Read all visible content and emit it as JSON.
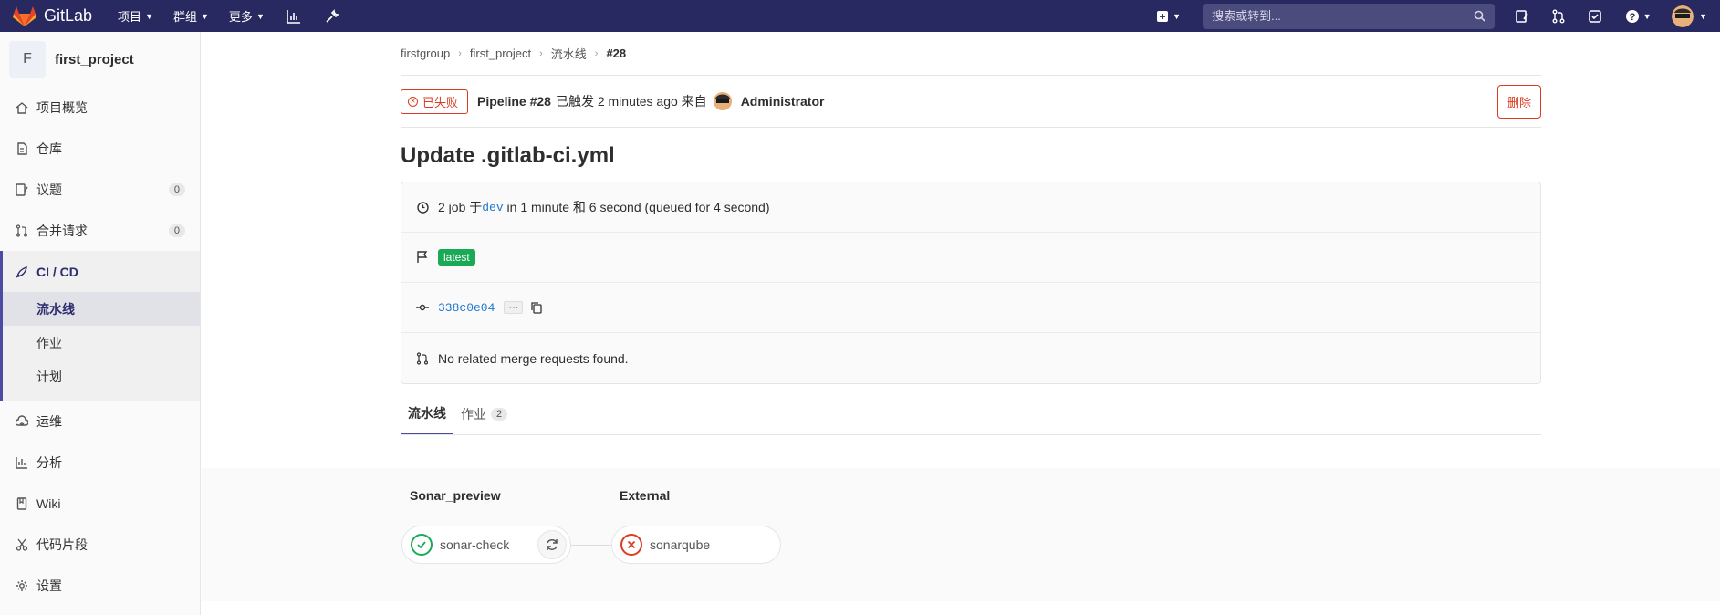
{
  "topbar": {
    "brand": "GitLab",
    "menu": [
      {
        "label": "项目"
      },
      {
        "label": "群组"
      },
      {
        "label": "更多"
      }
    ],
    "search_placeholder": "搜索或转到..."
  },
  "sidebar": {
    "project_initial": "F",
    "project_name": "first_project",
    "items": [
      {
        "label": "项目概览"
      },
      {
        "label": "仓库"
      },
      {
        "label": "议题",
        "count": "0"
      },
      {
        "label": "合并请求",
        "count": "0"
      }
    ],
    "cicd": {
      "label": "CI / CD",
      "subitems": [
        {
          "label": "流水线"
        },
        {
          "label": "作业"
        },
        {
          "label": "计划"
        }
      ]
    },
    "items_after": [
      {
        "label": "运维"
      },
      {
        "label": "分析"
      },
      {
        "label": "Wiki"
      },
      {
        "label": "代码片段"
      },
      {
        "label": "设置"
      }
    ]
  },
  "breadcrumb": [
    "firstgroup",
    "first_project",
    "流水线",
    "#28"
  ],
  "pipeline": {
    "status": "已失败",
    "title": "Pipeline #28",
    "meta": "已触发 2 minutes ago 来自",
    "author": "Administrator",
    "delete_label": "删除",
    "commit_title": "Update .gitlab-ci.yml",
    "info": {
      "jobs_prefix": "2 job 于",
      "branch": "dev",
      "jobs_suffix": " in 1 minute 和 6 second (queued for 4 second)",
      "tag": "latest",
      "commit_sha": "338c0e04",
      "ellipsis": "···",
      "mr_text": "No related merge requests found."
    },
    "tabs": [
      {
        "label": "流水线"
      },
      {
        "label": "作业",
        "count": "2"
      }
    ],
    "stages": [
      {
        "name": "Sonar_preview",
        "job": "sonar-check",
        "status": "passed"
      },
      {
        "name": "External",
        "job": "sonarqube",
        "status": "failed"
      }
    ]
  },
  "colors": {
    "navbar": "#292961",
    "danger": "#db3b21",
    "success": "#1aaa55",
    "link": "#1f78d1",
    "accent": "#4b4ba3"
  }
}
